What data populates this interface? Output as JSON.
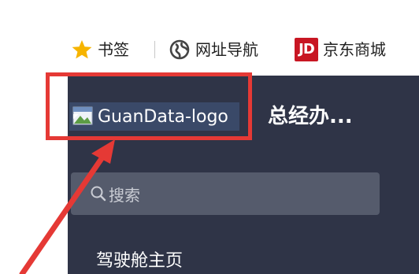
{
  "bookmarks": {
    "items": [
      {
        "label": "书签",
        "icon": "star-icon",
        "icon_color": "#f6b400"
      },
      {
        "label": "网址导航",
        "icon": "globe-icon"
      },
      {
        "label": "京东商城",
        "icon": "jd-icon",
        "icon_text": "JD",
        "icon_color": "#c81623"
      }
    ]
  },
  "app": {
    "logo_alt": "GuanData-logo",
    "title": "总经办...",
    "search": {
      "placeholder": "搜索"
    },
    "menu": {
      "first_item": "驾驶舱主页"
    },
    "colors": {
      "sidebar_bg": "#2f3447",
      "search_bg": "#555b6c",
      "logo_bg": "#3a4968"
    }
  },
  "annotation": {
    "color": "#e53935"
  }
}
